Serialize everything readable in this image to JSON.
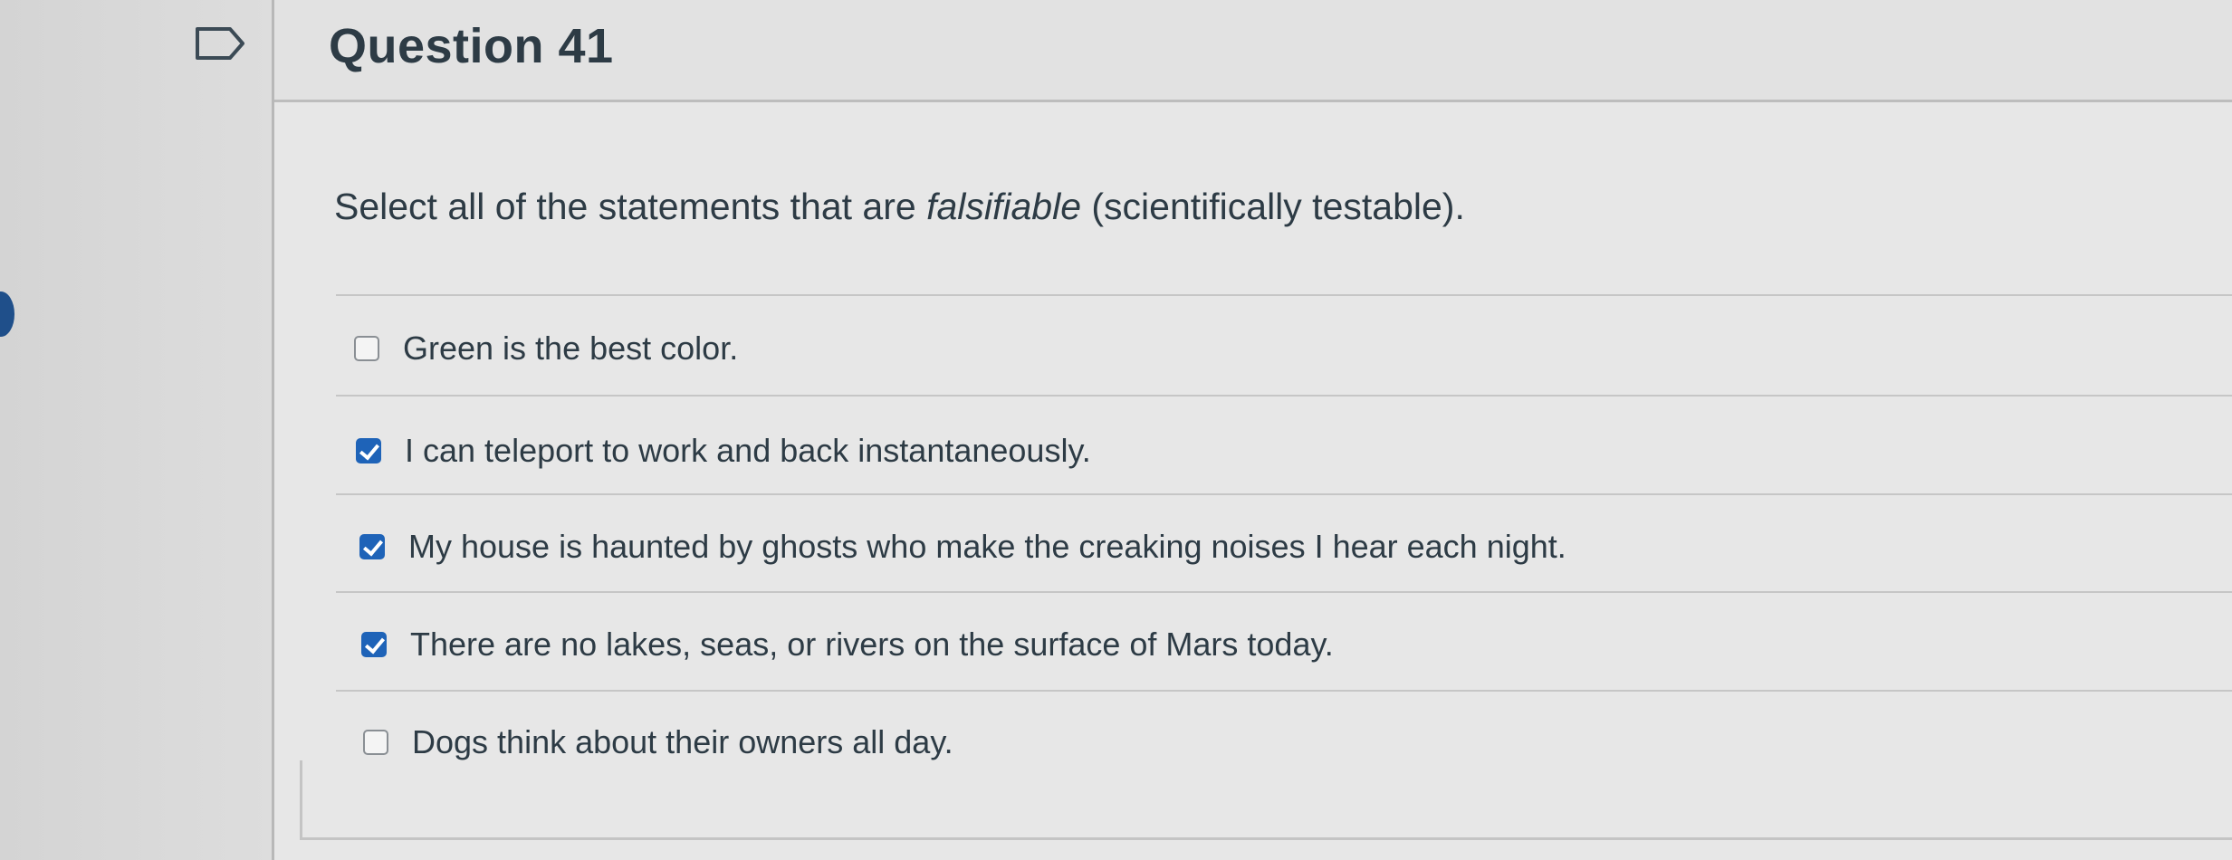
{
  "question": {
    "title": "Question 41",
    "prompt_start": "Select all of the statements that are ",
    "prompt_emphasis": "falsifiable",
    "prompt_end": " (scientifically testable).",
    "answers": [
      {
        "label": "Green is the best color.",
        "checked": false
      },
      {
        "label": "I can teleport to work and back instantaneously.",
        "checked": true
      },
      {
        "label": "My house is haunted by ghosts who make the creaking noises I hear each night.",
        "checked": true
      },
      {
        "label": "There are no lakes, seas, or rivers on the surface of Mars today.",
        "checked": true
      },
      {
        "label": "Dogs think about their owners all day.",
        "checked": false
      }
    ]
  },
  "colors": {
    "accent": "#1e63b8",
    "text": "#2d3b45"
  }
}
